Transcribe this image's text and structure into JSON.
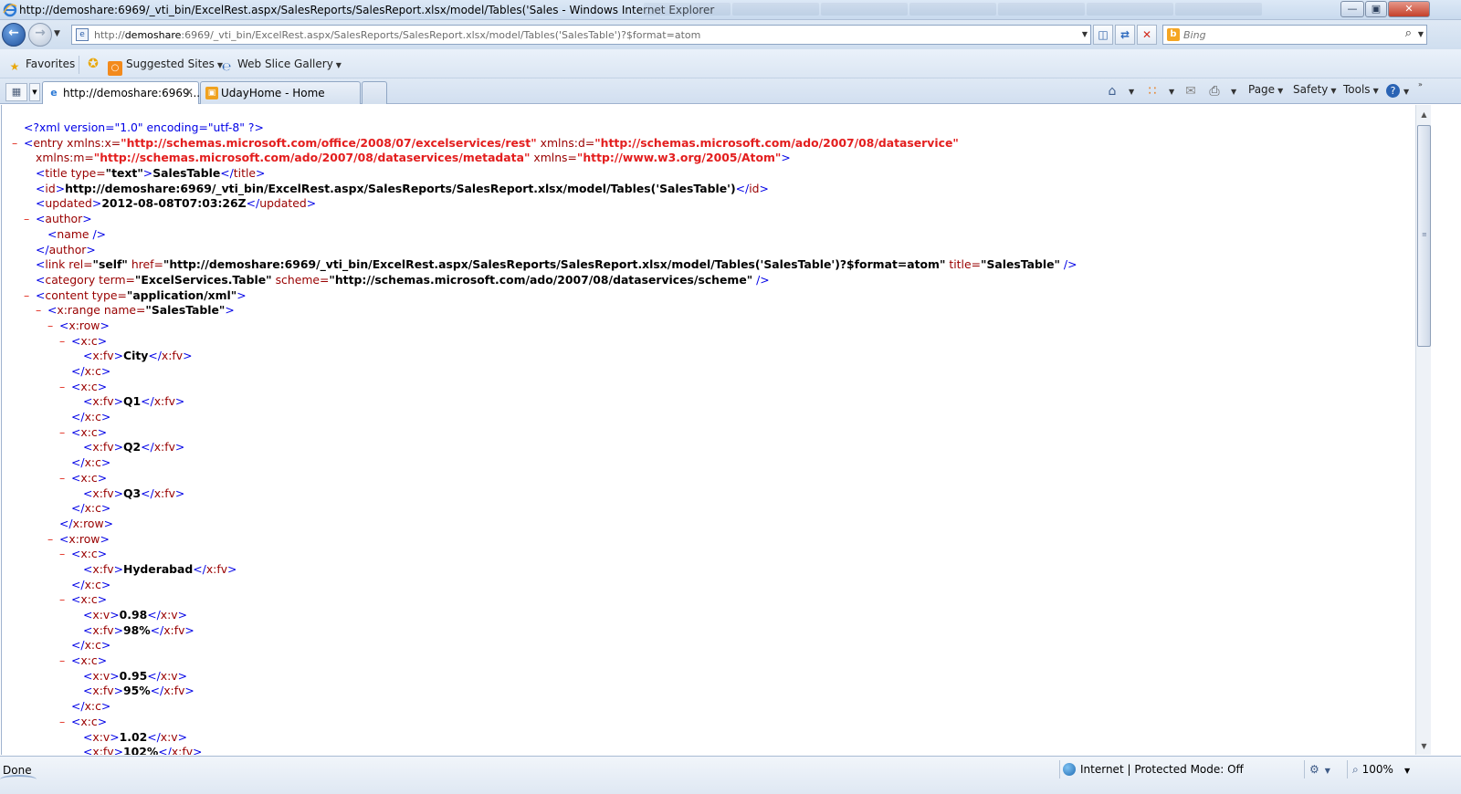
{
  "window": {
    "title": "http://demoshare:6969/_vti_bin/ExcelRest.aspx/SalesReports/SalesReport.xlsx/model/Tables('Sales - Windows Internet Explorer"
  },
  "address": {
    "url_prefix": "http://",
    "url_host": "demoshare",
    "url_rest": ":6969/_vti_bin/ExcelRest.aspx/SalesReports/SalesReport.xlsx/model/Tables('SalesTable')?$format=atom"
  },
  "search": {
    "placeholder": "Bing"
  },
  "favorites_bar": {
    "favorites_label": "Favorites",
    "suggested_sites": "Suggested Sites",
    "web_slice_gallery": "Web Slice Gallery"
  },
  "tabs": [
    {
      "label": "http://demoshare:6969...",
      "active": true
    },
    {
      "label": "UdayHome - Home",
      "active": false
    }
  ],
  "command_bar": {
    "page": "Page",
    "safety": "Safety",
    "tools": "Tools"
  },
  "xml": {
    "decl": "<?xml version=\"1.0\" encoding=\"utf-8\" ?>",
    "entry_open": "<entry",
    "ns_x_attr": "xmlns:x=",
    "ns_x_val": "\"http://schemas.microsoft.com/office/2008/07/excelservices/rest\"",
    "ns_d_attr": "xmlns:d=",
    "ns_d_val": "\"http://schemas.microsoft.com/ado/2007/08/dataservice\"",
    "ns_m_attr": "xmlns:m=",
    "ns_m_val": "\"http://schemas.microsoft.com/ado/2007/08/dataservices/metadata\"",
    "ns_attr": "xmlns=",
    "ns_val": "\"http://www.w3.org/2005/Atom\"",
    "title_type": "\"text\"",
    "title_value": "SalesTable",
    "id_value": "http://demoshare:6969/_vti_bin/ExcelRest.aspx/SalesReports/SalesReport.xlsx/model/Tables('SalesTable')",
    "updated_value": "2012-08-08T07:03:26Z",
    "link_rel": "\"self\"",
    "link_href": "\"http://demoshare:6969/_vti_bin/ExcelRest.aspx/SalesReports/SalesReport.xlsx/model/Tables('SalesTable')?$format=atom\"",
    "link_title": "\"SalesTable\"",
    "category_term": "\"ExcelServices.Table\"",
    "category_scheme": "\"http://schemas.microsoft.com/ado/2007/08/dataservices/scheme\"",
    "content_type": "\"application/xml\"",
    "range_name": "\"SalesTable\"",
    "header_cells": [
      "City",
      "Q1",
      "Q2",
      "Q3"
    ],
    "row2": {
      "city": "Hyderabad",
      "cells": [
        {
          "v": "0.98",
          "fv": "98%"
        },
        {
          "v": "0.95",
          "fv": "95%"
        },
        {
          "v": "1.02",
          "fv": "102%"
        }
      ]
    }
  },
  "status": {
    "text": "Done",
    "zone": "Internet | Protected Mode: Off",
    "zoom": "100%"
  }
}
